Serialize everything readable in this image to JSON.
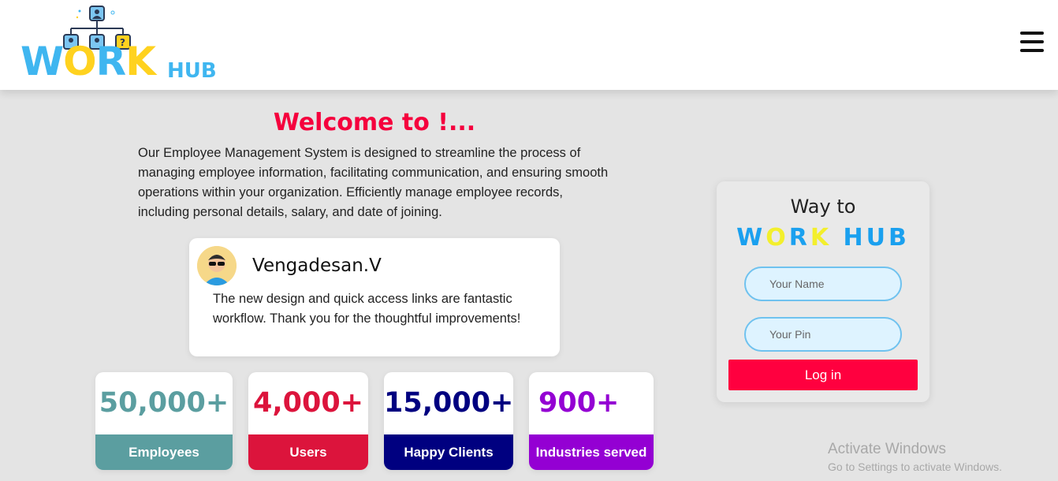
{
  "brand": {
    "word_parts": [
      "W",
      "O",
      "R",
      "K"
    ],
    "hub": "HUB"
  },
  "menu": {
    "icon": "hamburger-menu-icon"
  },
  "welcome": {
    "title": "Welcome to !...",
    "text": "Our Employee Management System is designed to streamline the process of managing employee information, facilitating communication, and ensuring smooth operations within your organization. Efficiently manage employee records, including personal details, salary, and date of joining."
  },
  "testimonial": {
    "name": "Vengadesan.V",
    "text": "The new design and quick access links are fantastic workflow. Thank you for the thoughtful improvements!",
    "avatar_icon": "user-avatar-icon"
  },
  "stats": [
    {
      "value": "50,000+",
      "label": "Employees",
      "color": "#5b9ea0"
    },
    {
      "value": "4,000+",
      "label": "Users",
      "color": "#dc143c"
    },
    {
      "value": "15,000+",
      "label": "Happy Clients",
      "color": "#000080"
    },
    {
      "value": "900+",
      "label": "Industries served",
      "color": "#9400d3"
    }
  ],
  "login": {
    "title": "Way to",
    "brand_parts": [
      "W",
      "O",
      "R",
      "K",
      "HUB"
    ],
    "name_placeholder": "Your Name",
    "pin_placeholder": "Your Pin",
    "button": "Log in"
  },
  "watermark": {
    "title": "Activate Windows",
    "subtitle": "Go to Settings to activate Windows."
  },
  "colors": {
    "accent_red": "#ff003f",
    "brand_blue": "#3fb6f0",
    "brand_yellow": "#ffd21f"
  }
}
